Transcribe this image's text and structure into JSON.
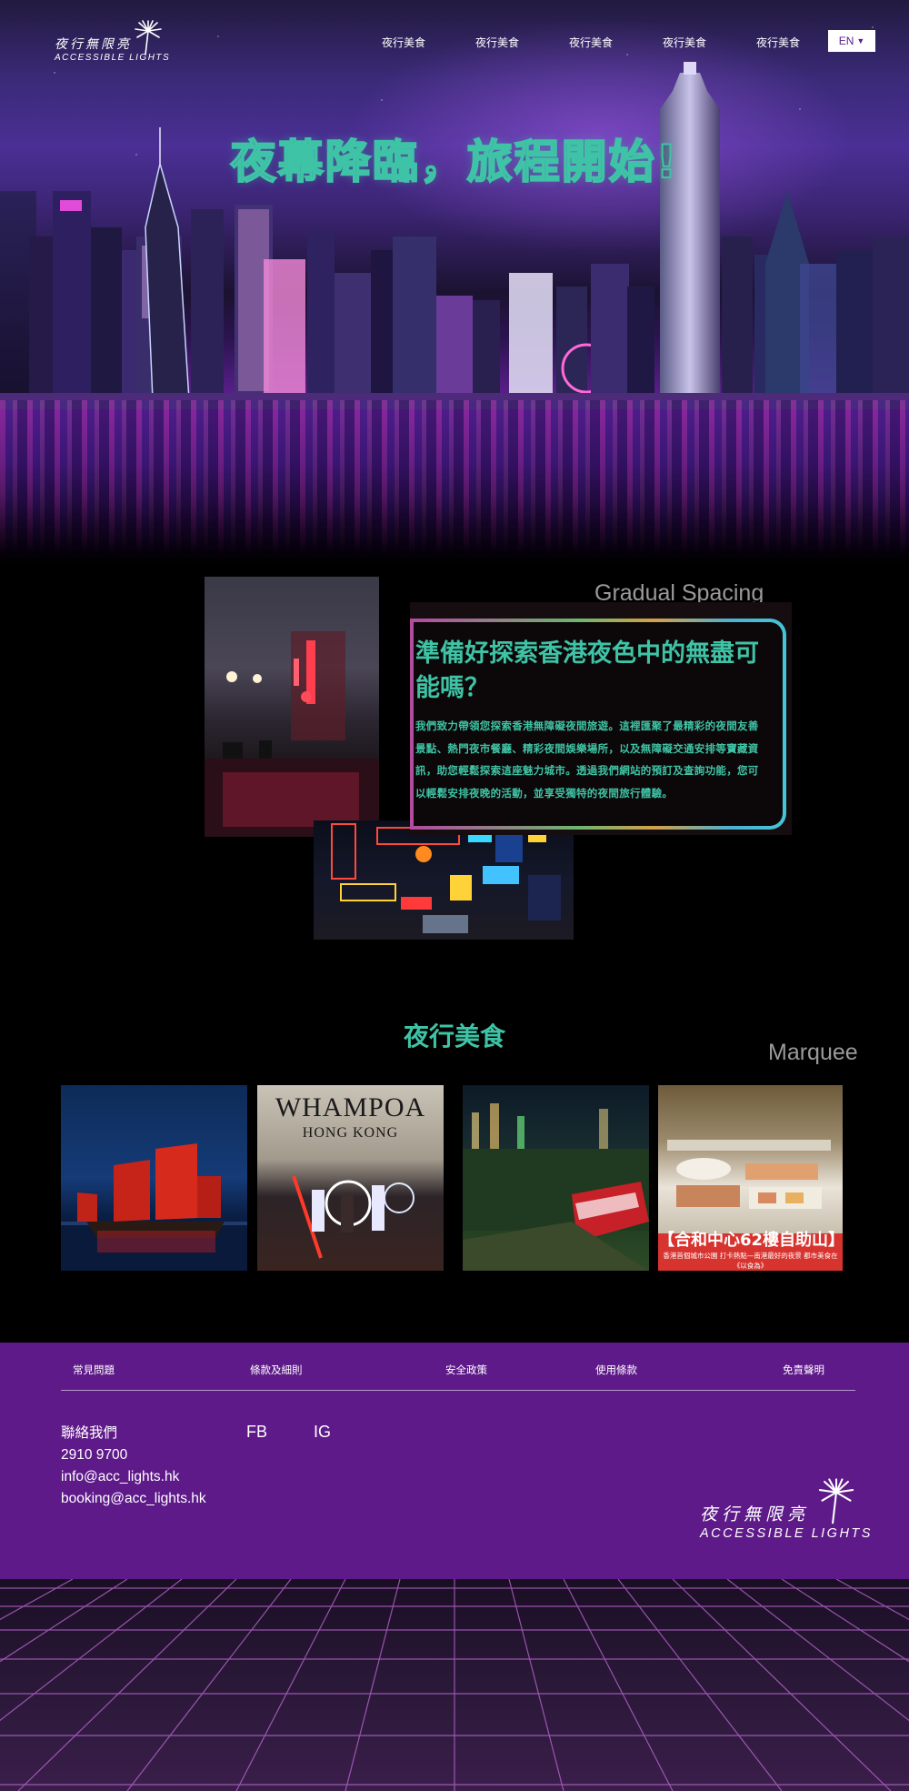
{
  "brand": {
    "name_zh": "夜行無限亮",
    "name_en": "ACCESSIBLE LIGHTS"
  },
  "nav": {
    "items": [
      "夜行美食",
      "夜行美食",
      "夜行美食",
      "夜行美食",
      "夜行美食"
    ],
    "language": "EN"
  },
  "hero": {
    "title": "夜幕降臨，旅程開始!"
  },
  "about": {
    "effect_label": "Gradual Spacing",
    "heading": "準備好探索香港夜色中的無盡可能嗎？",
    "body": "我們致力帶領您探索香港無障礙夜間旅遊。這裡匯聚了最精彩的夜間友善景點、熱門夜市餐廳、精彩夜間娛樂場所，以及無障礙交通安排等寶藏資訊，助您輕鬆探索這座魅力城市。透過我們網站的預訂及查詢功能，您可以輕鬆安排夜晚的活動，並享受獨特的夜間旅行體驗。"
  },
  "food": {
    "title": "夜行美食",
    "effect_label": "Marquee",
    "cards": [
      {
        "image": "junk-boat-night-photo"
      },
      {
        "image": "whampoa-performance-photo",
        "sign_title": "WHAMPOA",
        "sign_subtitle": "HONG KONG"
      },
      {
        "image": "peak-tram-night-photo"
      },
      {
        "image": "buffet-photo",
        "banner_title": "【合和中心62樓自助山】",
        "banner_subtitle": "香港首個城市公園 打卡熱點—南港最好的夜景 都市美食在《以食為》"
      }
    ]
  },
  "footer": {
    "links": [
      "常見問題",
      "條款及細則",
      "安全政策",
      "使用條款",
      "免責聲明"
    ],
    "contact": {
      "label": "聯絡我們",
      "phone": "2910 9700",
      "email_info": "info@acc_lights.hk",
      "email_booking": "booking@acc_lights.hk"
    },
    "social": {
      "fb": "FB",
      "ig": "IG"
    }
  },
  "colors": {
    "accent": "#3fc3a6",
    "footer_bg": "#5e1a89",
    "label_grey": "#9a9a9a"
  }
}
